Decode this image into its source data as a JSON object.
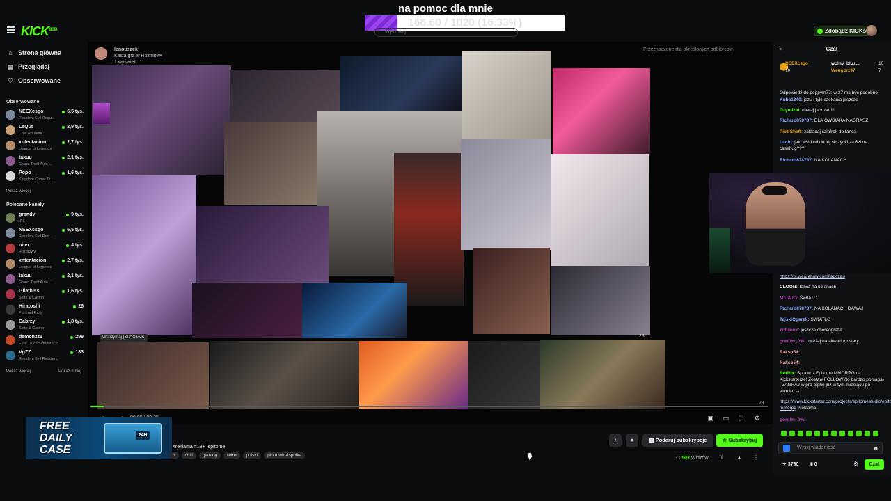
{
  "header": {
    "goal_title": "na pomoc dla mnie",
    "goal_progress_text": "166.60 / 1020 (16.33%)",
    "goal_fraction": 0.1633,
    "logo_text": "KICK",
    "logo_sup": "BETA",
    "kicks_button": "Zdobądź KICKs",
    "search_placeholder": "Wyszukaj"
  },
  "sidebar": {
    "nav": [
      {
        "label": "Strona główna",
        "icon": "home-icon"
      },
      {
        "label": "Przeglądaj",
        "icon": "browse-icon"
      },
      {
        "label": "Obserwowane",
        "icon": "heart-icon"
      }
    ],
    "followed_title": "Obserwowane",
    "followed": [
      {
        "name": "NEEXcsgo",
        "game": "Resident Evil Requ...",
        "viewers": "6,5 tys.",
        "color": "#7a8a9a"
      },
      {
        "name": "LeQut",
        "game": "Chat Roulette",
        "viewers": "2,9 tys.",
        "color": "#c9a27a"
      },
      {
        "name": "xntentacion",
        "game": "League of Legends",
        "viewers": "2,7 tys.",
        "color": "#b08968"
      },
      {
        "name": "takuu",
        "game": "Grand Theft Auto ...",
        "viewers": "2,1 tys.",
        "color": "#8c5a8c"
      },
      {
        "name": "Popo",
        "game": "Kingdom Come: D...",
        "viewers": "1,6 tys.",
        "color": "#d8d8d8"
      }
    ],
    "followed_more": "Pokaż więcej",
    "recommended_title": "Polecane kanały",
    "recommended": [
      {
        "name": "grandy",
        "game": "IRL",
        "viewers": "9 tys.",
        "color": "#6e7b52"
      },
      {
        "name": "NEEXcsgo",
        "game": "Resident Evil Req...",
        "viewers": "6,5 tys.",
        "color": "#7a8a9a"
      },
      {
        "name": "niter",
        "game": "Rozmowy",
        "viewers": "4 tys.",
        "color": "#b33a3a"
      },
      {
        "name": "xntentacion",
        "game": "League of Legends",
        "viewers": "2,7 tys.",
        "color": "#b08968"
      },
      {
        "name": "takuu",
        "game": "Grand Theft Auto ...",
        "viewers": "2,1 tys.",
        "color": "#8c5a8c"
      },
      {
        "name": "Gilathiss",
        "game": "Slots & Casino",
        "viewers": "1,6 tys.",
        "color": "#a8324a"
      },
      {
        "name": "Hiratoshi",
        "game": "Pummel Party",
        "viewers": "26",
        "color": "#3a3a3a"
      },
      {
        "name": "Cabrzy",
        "game": "Slots & Casino",
        "viewers": "1,8 tys.",
        "color": "#9a9a9a"
      },
      {
        "name": "demonzz1",
        "game": "Euro Truck Simulator 2",
        "viewers": "299",
        "color": "#c04a2a"
      },
      {
        "name": "VgZZ",
        "game": "Resident Evil Requiem",
        "viewers": "183",
        "color": "#2f6b8a"
      }
    ],
    "recommended_more": "Pokaż więcej",
    "recommended_less": "Pokaż mniej"
  },
  "video": {
    "overlay_user": "lenouszek",
    "overlay_line1": "Kasia gra w Rozmowy",
    "overlay_line2": "1 wyświetl.",
    "top_right_note": "Przeznaczone dla określonych odbiorców",
    "pause_tip": "Wstrzymaj (SPACJA/K)",
    "time": "00:00 / 00:25",
    "progress_fraction": 0.02,
    "counter_a": "23",
    "counter_b": "23"
  },
  "chat": {
    "title": "Czat",
    "pinned": [
      {
        "name": "NEEXcsgo",
        "num": "10",
        "color": "#e6a21a"
      },
      {
        "name": "wolny_blus...",
        "num": "10",
        "color": "#e8e8e8"
      },
      {
        "name": "Wengorz97",
        "num": "7",
        "color": "#e6a21a"
      }
    ],
    "messages_top": [
      {
        "user": "",
        "text": "Odpowiedź do poppym77: w 27 ma byc podobno",
        "ucolor": "#9a9a9a"
      },
      {
        "user": "Kuba1340:",
        "text": " jezu i tyle czekania jeszcze",
        "ucolor": "#8aa8ff"
      },
      {
        "user": "Dzyndzel:",
        "text": " dawaj japczan!!!!",
        "ucolor": "#53fc18"
      },
      {
        "user": "Richard878787:",
        "text": " DLA OWSIAKA NAGRASZ",
        "ucolor": "#8aa8ff"
      },
      {
        "user": "PiotrSheff:",
        "text": " zakładaj szlafrok do tanca",
        "ucolor": "#e6a21a"
      },
      {
        "user": "Lanio:",
        "text": " jaki jest kod do tej skrzynki za 8zl na casehug???",
        "ucolor": "#8aa8ff"
      },
      {
        "user": "Richard878787:",
        "text": " NA KOLANACH",
        "ucolor": "#8aa8ff"
      }
    ],
    "messages_bottom": [
      {
        "user": "",
        "text": "https://pl.weareholy.com/japczan",
        "ucolor": "#c8d9ff",
        "link": true
      },
      {
        "user": "CLOON:",
        "text": " Tańcz na kolanach",
        "ucolor": "#e8e8e8"
      },
      {
        "user": "MrJAJO:",
        "text": " ŚWIATO",
        "ucolor": "#b34ab3"
      },
      {
        "user": "Richard878787:",
        "text": " NA KOLANACH DAWAJ",
        "ucolor": "#8aa8ff"
      },
      {
        "user": "TajskiOgarek:",
        "text": " ŚWIATŁO",
        "ucolor": "#8aa8ff"
      },
      {
        "user": "zofiannx:",
        "text": " jeszcze choreografia",
        "ucolor": "#b34ab3"
      },
      {
        "user": "gord0n_0%:",
        "text": " uważaj na akwarium stary",
        "ucolor": "#b34ab3"
      },
      {
        "user": "Rakso54:",
        "text": "",
        "ucolor": "#e8a0a0"
      },
      {
        "user": "Rakso54:",
        "text": "",
        "ucolor": "#e8a0a0"
      },
      {
        "user": "BotRix:",
        "text": " Sprawdź Epitome MMORPG na Kickstarterze! Zostaw FOLLOW (to bardzo pomaga) i ZAGRAJ w pre-alphę już w tym miesiącu po starcie. →",
        "ucolor": "#53fc18"
      },
      {
        "user": "",
        "text": "https://www.kickstarter.com/projects/epitomestudio/epitome-mmorpg",
        "ucolor": "#c8d9ff",
        "link": true,
        "suffix": " #reklama"
      },
      {
        "user": "gord0n_0%:",
        "text": "",
        "ucolor": "#b34ab3"
      }
    ],
    "input_placeholder": "Wyślij wiadomość",
    "points": "3790",
    "points2": "0",
    "send_label": "Czat"
  },
  "below": {
    "ad_line1": "FREE",
    "ad_line2": "DAILY",
    "ad_line3": "CASE",
    "ad_box_label": "24H",
    "stream_title": "#reklama #18+ !epitome",
    "tags": [
      "h",
      "chill",
      "gaming",
      "retro",
      "polski",
      "piotrowiczispulka"
    ],
    "gift_sub": "Podaruj subskrypcje",
    "subscribe": "Subskrybuj",
    "viewers_count": "503",
    "viewers_label": "Widzów"
  },
  "colors": {
    "accent": "#53fc18",
    "background": "#0b0c0e",
    "chat_bg": "#0f1012"
  }
}
